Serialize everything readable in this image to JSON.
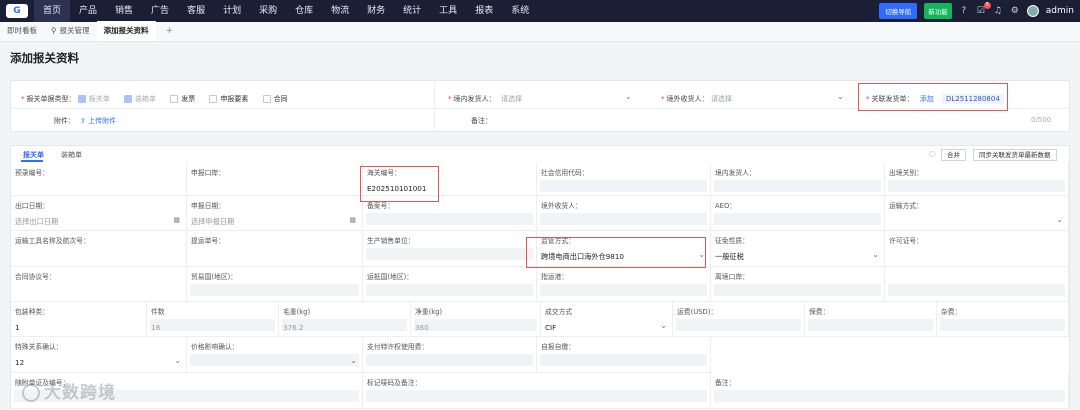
{
  "nav": {
    "logo_text": "G",
    "items": [
      "首页",
      "产品",
      "销售",
      "广告",
      "客服",
      "计划",
      "采购",
      "仓库",
      "物流",
      "财务",
      "统计",
      "工具",
      "报表",
      "系统"
    ],
    "switch_label": "切换导航",
    "new_label": "新功能",
    "badge_count": "5",
    "username": "admin"
  },
  "tabs": {
    "items": [
      {
        "label": "即时看板"
      },
      {
        "label": "报关管理"
      },
      {
        "label": "添加报关资料"
      }
    ],
    "plus": "+"
  },
  "page_title": "添加报关资料",
  "form": {
    "doc_type_label": "报关单据类型：",
    "doc_types": [
      {
        "label": "报关单",
        "checked": true
      },
      {
        "label": "装箱单",
        "checked": true
      },
      {
        "label": "发票",
        "checked": false
      },
      {
        "label": "申报要素",
        "checked": false
      },
      {
        "label": "合同",
        "checked": false
      }
    ],
    "domestic_shipper_label": "境内发货人：",
    "domestic_shipper_placeholder": "请选择",
    "overseas_consignee_label": "境外收货人：",
    "overseas_consignee_placeholder": "请选择",
    "linked_invoice_label": "关联发货单：",
    "linked_invoice_add": "添加",
    "linked_invoice_tag": "DL2511280804",
    "attachment_label": "附件：",
    "upload_label": "上传附件",
    "remark_label": "备注：",
    "remark_count": "0/500"
  },
  "decl": {
    "tab_decl": "报关单",
    "tab_packing": "装箱单",
    "merge_btn": "合并",
    "sync_btn": "同步关联发货单最新数据",
    "rows": [
      [
        {
          "label": "预录编号："
        },
        {
          "label": "申报口岸："
        },
        {
          "label": "海关编号：",
          "value": "E202510101001"
        },
        {
          "label": "社会信用代码："
        },
        {
          "label": "境内发货人："
        },
        {
          "label": "出境关别："
        }
      ],
      [
        {
          "label": "出口日期：",
          "value": "选择出口日期"
        },
        {
          "label": "申报日期：",
          "value": "选择申报日期"
        },
        {
          "label": "备案号："
        },
        {
          "label": "境外收货人："
        },
        {
          "label": "AEO："
        },
        {
          "label": "运输方式："
        }
      ],
      [
        {
          "label": "运输工具名称及航次号："
        },
        {
          "label": "提运单号："
        },
        {
          "label": "生产销售单位："
        },
        {
          "label": "监管方式：",
          "value": "跨境电商出口海外仓9810"
        },
        {
          "label": "征免性质：",
          "value": "一般征税"
        },
        {
          "label": "许可证号："
        }
      ],
      [
        {
          "label": "合同协议号："
        },
        {
          "label": "贸易国(地区)："
        },
        {
          "label": "运抵国(地区)："
        },
        {
          "label": "指运港："
        },
        {
          "label": "离境口岸："
        },
        {
          "label": ""
        }
      ],
      [
        {
          "label": "包装种类：",
          "value": "1"
        },
        {
          "label": "件数",
          "value": "18"
        },
        {
          "label": "毛重(kg)",
          "value": "376.2"
        },
        {
          "label": "净重(kg)",
          "value": "360"
        },
        {
          "label": "成交方式",
          "value": "CIF"
        },
        {
          "label": "运费(USD)："
        },
        {
          "label": "保费："
        },
        {
          "label": "杂费："
        }
      ],
      [
        {
          "label": "特殊关系确认：",
          "value": "12"
        },
        {
          "label": "价格影响确认："
        },
        {
          "label": "支付特许权使用费："
        },
        {
          "label": "自报自缴："
        }
      ],
      [
        {
          "label": "随附单证及编号："
        },
        {
          "label": "标记唛码及备注："
        },
        {
          "label": "备注："
        }
      ]
    ]
  },
  "watermark": "大数跨境",
  "colors": {
    "nav_bg": "#1a1f36",
    "accent": "#2f6bff",
    "green": "#11b65e",
    "required": "#e53935",
    "highlight_box": "#e05555"
  }
}
